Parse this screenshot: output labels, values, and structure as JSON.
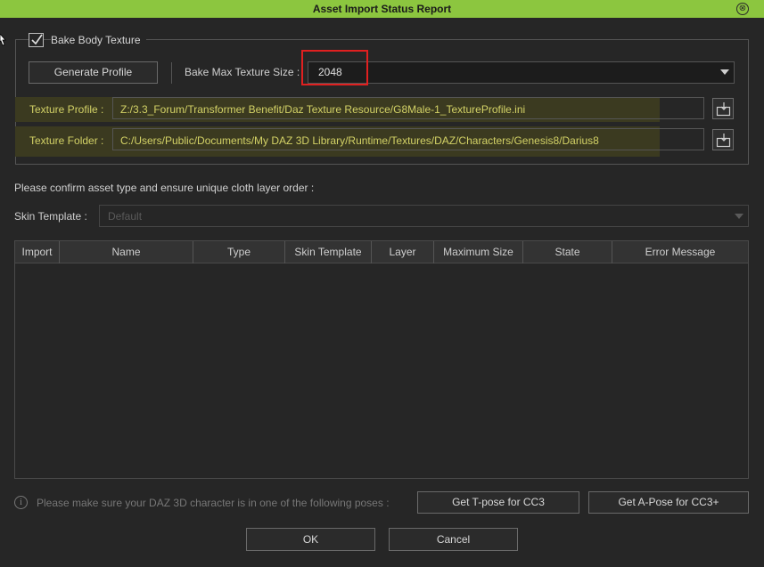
{
  "window": {
    "title": "Asset Import Status Report",
    "close_icon": "⊗"
  },
  "bake_group": {
    "checkbox_label": "Bake Body Texture",
    "checked": true,
    "generate_profile_label": "Generate Profile",
    "max_size_label": "Bake Max Texture Size :",
    "max_size_value": "2048",
    "texture_profile_label": "Texture Profile :",
    "texture_profile_value": "Z:/3.3_Forum/Transformer Benefit/Daz Texture Resource/G8Male-1_TextureProfile.ini",
    "texture_folder_label": "Texture Folder :",
    "texture_folder_value": "C:/Users/Public/Documents/My DAZ 3D Library/Runtime/Textures/DAZ/Characters/Genesis8/Darius8",
    "browse_icon": "folder-open-icon"
  },
  "confirm_text": "Please confirm asset type and ensure unique cloth layer order :",
  "skin_template": {
    "label": "Skin Template :",
    "value": "Default"
  },
  "table": {
    "columns": [
      "Import",
      "Name",
      "Type",
      "Skin Template",
      "Layer",
      "Maximum Size",
      "State",
      "Error Message"
    ],
    "rows": []
  },
  "footer": {
    "info_icon": "i",
    "pose_text": "Please make sure your DAZ 3D character is in one of the following poses :",
    "tpose_label": "Get T-pose for CC3",
    "apose_label": "Get A-Pose for CC3+",
    "ok_label": "OK",
    "cancel_label": "Cancel"
  },
  "colors": {
    "titlebar": "#8cc63f",
    "highlight": "#3b3a20",
    "highlight_text": "#d3d266",
    "annotation": "#e02020"
  }
}
